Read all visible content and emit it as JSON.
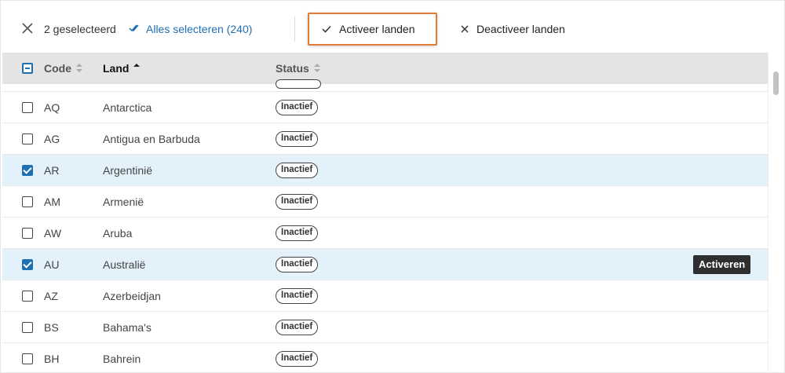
{
  "toolbar": {
    "selected_count": "2 geselecteerd",
    "select_all": "Alles selecteren (240)",
    "activate": "Activeer landen",
    "deactivate": "Deactiveer landen"
  },
  "table": {
    "columns": {
      "code": "Code",
      "land": "Land",
      "status": "Status"
    },
    "sort": {
      "column": "Land",
      "direction": "ascending"
    },
    "rows": [
      {
        "code": "AQ",
        "land": "Antarctica",
        "status": "Inactief",
        "checked": false
      },
      {
        "code": "AG",
        "land": "Antigua en Barbuda",
        "status": "Inactief",
        "checked": false
      },
      {
        "code": "AR",
        "land": "Argentinië",
        "status": "Inactief",
        "checked": true
      },
      {
        "code": "AM",
        "land": "Armenië",
        "status": "Inactief",
        "checked": false
      },
      {
        "code": "AW",
        "land": "Aruba",
        "status": "Inactief",
        "checked": false
      },
      {
        "code": "AU",
        "land": "Australië",
        "status": "Inactief",
        "checked": true,
        "tooltip": "Activeren"
      },
      {
        "code": "AZ",
        "land": "Azerbeidjan",
        "status": "Inactief",
        "checked": false
      },
      {
        "code": "BS",
        "land": "Bahama's",
        "status": "Inactief",
        "checked": false
      },
      {
        "code": "BH",
        "land": "Bahrein",
        "status": "Inactief",
        "checked": false
      }
    ]
  },
  "colors": {
    "accent": "#1f6fb2",
    "highlight_border": "#e07b39",
    "selected_row": "#e3f1fb",
    "header_bg": "#e4e4e4"
  },
  "icons": {
    "clear_selection": "close-icon",
    "select_all": "double-check-icon",
    "activate": "check-icon",
    "deactivate": "close-icon"
  }
}
